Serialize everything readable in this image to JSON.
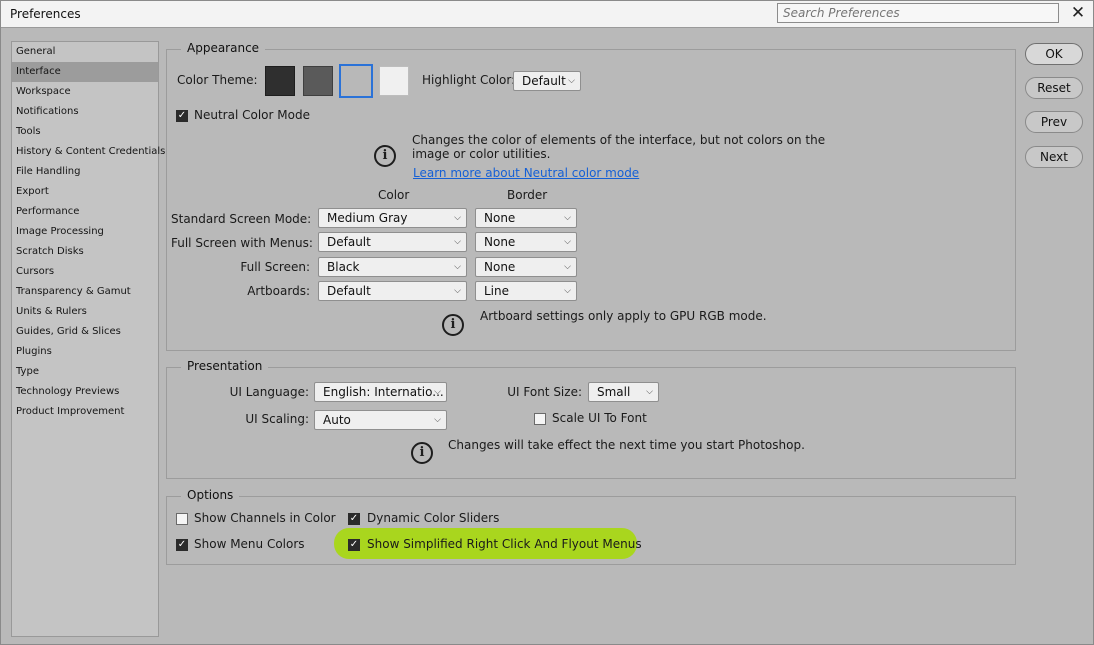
{
  "window": {
    "title": "Preferences",
    "search_placeholder": "Search Preferences"
  },
  "sidebar": {
    "items": [
      "General",
      "Interface",
      "Workspace",
      "Notifications",
      "Tools",
      "History & Content Credentials",
      "File Handling",
      "Export",
      "Performance",
      "Image Processing",
      "Scratch Disks",
      "Cursors",
      "Transparency & Gamut",
      "Units & Rulers",
      "Guides, Grid & Slices",
      "Plugins",
      "Type",
      "Technology Previews",
      "Product Improvement"
    ],
    "selected": "Interface"
  },
  "appearance": {
    "legend": "Appearance",
    "color_theme_label": "Color Theme:",
    "themes": [
      "#2f2f2f",
      "#5a5a5a",
      "#b8b8b8",
      "#f0f0f0"
    ],
    "highlight_label": "Highlight Color:",
    "highlight_value": "Default",
    "neutral_mode_label": "Neutral Color Mode",
    "neutral_mode_checked": true,
    "neutral_info_line1": "Changes the color of elements of the interface, but not colors on the",
    "neutral_info_line2": "image or color utilities.",
    "neutral_link": "Learn more about Neutral color mode",
    "col_color": "Color",
    "col_border": "Border",
    "rows": [
      {
        "label": "Standard Screen Mode:",
        "color": "Medium Gray",
        "border": "None"
      },
      {
        "label": "Full Screen with Menus:",
        "color": "Default",
        "border": "None"
      },
      {
        "label": "Full Screen:",
        "color": "Black",
        "border": "None"
      },
      {
        "label": "Artboards:",
        "color": "Default",
        "border": "Line"
      }
    ],
    "artboard_info": "Artboard settings only apply to GPU RGB mode."
  },
  "presentation": {
    "legend": "Presentation",
    "ui_language_label": "UI Language:",
    "ui_language_value": "English: Internatio...",
    "ui_font_size_label": "UI Font Size:",
    "ui_font_size_value": "Small",
    "ui_scaling_label": "UI Scaling:",
    "ui_scaling_value": "Auto",
    "scale_ui_label": "Scale UI To Font",
    "scale_ui_checked": false,
    "restart_info": "Changes will take effect the next time you start Photoshop."
  },
  "options": {
    "legend": "Options",
    "show_channels_label": "Show Channels in Color",
    "show_channels_checked": false,
    "dynamic_sliders_label": "Dynamic Color Sliders",
    "dynamic_sliders_checked": true,
    "show_menu_colors_label": "Show Menu Colors",
    "show_menu_colors_checked": true,
    "simplified_menus_label": "Show Simplified Right Click And Flyout Menus",
    "simplified_menus_checked": true,
    "highlight_color": "#a9d61e"
  },
  "buttons": {
    "ok": "OK",
    "reset": "Reset",
    "prev": "Prev",
    "next": "Next"
  }
}
